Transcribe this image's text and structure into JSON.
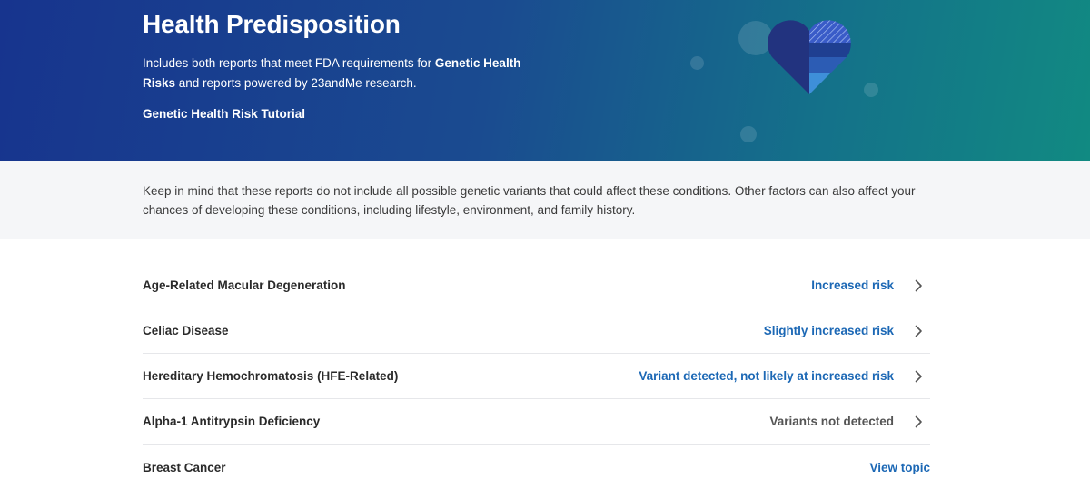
{
  "hero": {
    "title": "Health Predisposition",
    "desc_part1": "Includes both reports that meet FDA requirements for ",
    "desc_bold": "Genetic Health Risks",
    "desc_part2": " and reports powered by 23andMe research.",
    "tutorial_link": "Genetic Health Risk Tutorial",
    "illustration_icon": "heart-icon",
    "colors": {
      "gradient_start": "#17348e",
      "gradient_end": "#118a82"
    }
  },
  "notice": {
    "text": "Keep in mind that these reports do not include all possible genetic variants that could affect these conditions. Other factors can also affect your chances of developing these conditions, including lifestyle, environment, and family history."
  },
  "reports": [
    {
      "name": "Age-Related Macular Degeneration",
      "status": "Increased risk",
      "tone": "highlight",
      "icon": "chevron-right-icon"
    },
    {
      "name": "Celiac Disease",
      "status": "Slightly increased risk",
      "tone": "highlight",
      "icon": "chevron-right-icon"
    },
    {
      "name": "Hereditary Hemochromatosis (HFE-Related)",
      "status": "Variant detected, not likely at increased risk",
      "tone": "highlight",
      "icon": "chevron-right-icon"
    },
    {
      "name": "Alpha-1 Antitrypsin Deficiency",
      "status": "Variants not detected",
      "tone": "neutral",
      "icon": "chevron-right-icon"
    },
    {
      "name": "Breast Cancer",
      "status": "View topic",
      "tone": "highlight",
      "icon": ""
    }
  ],
  "colors": {
    "link_blue": "#1c68b5",
    "neutral_text": "#555555",
    "notice_bg": "#f5f6f8"
  }
}
